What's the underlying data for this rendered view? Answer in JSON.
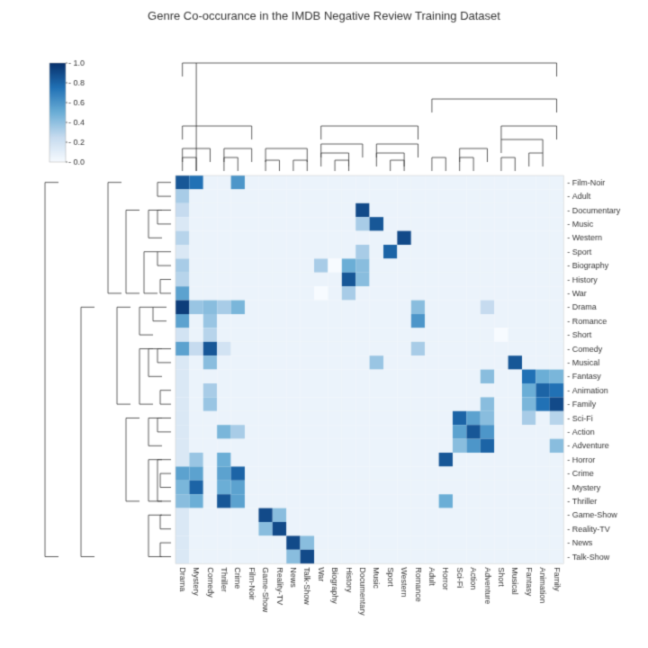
{
  "title": "Genre Co-occurance in the IMDB Negative Review Training Dataset",
  "colorscale": {
    "min": 0.0,
    "max": 1.0,
    "steps": [
      1.0,
      0.8,
      0.6,
      0.4,
      0.2,
      0.0
    ]
  },
  "genres_x": [
    "Drama",
    "Mystery",
    "Comedy",
    "Thriller",
    "Crime",
    "Film-Noir",
    "Game-Show",
    "Reality-TV",
    "News",
    "Talk-Show",
    "War",
    "Biography",
    "History",
    "Documentary",
    "Music",
    "Sport",
    "Western",
    "Romance",
    "Adult",
    "Horror",
    "Sci-Fi",
    "Action",
    "Adventure",
    "Short",
    "Musical",
    "Fantasy",
    "Animation",
    "Family"
  ],
  "genres_y": [
    "Film-Noir",
    "Adult",
    "Documentary",
    "Music",
    "Western",
    "Sport",
    "Biography",
    "History",
    "War",
    "Drama",
    "Romance",
    "Short",
    "Comedy",
    "Musical",
    "Fantasy",
    "Animation",
    "Family",
    "Sci-Fi",
    "Action",
    "Adventure",
    "Horror",
    "Crime",
    "Mystery",
    "Thriller",
    "Game-Show",
    "Reality-TV",
    "News",
    "Talk-Show"
  ]
}
